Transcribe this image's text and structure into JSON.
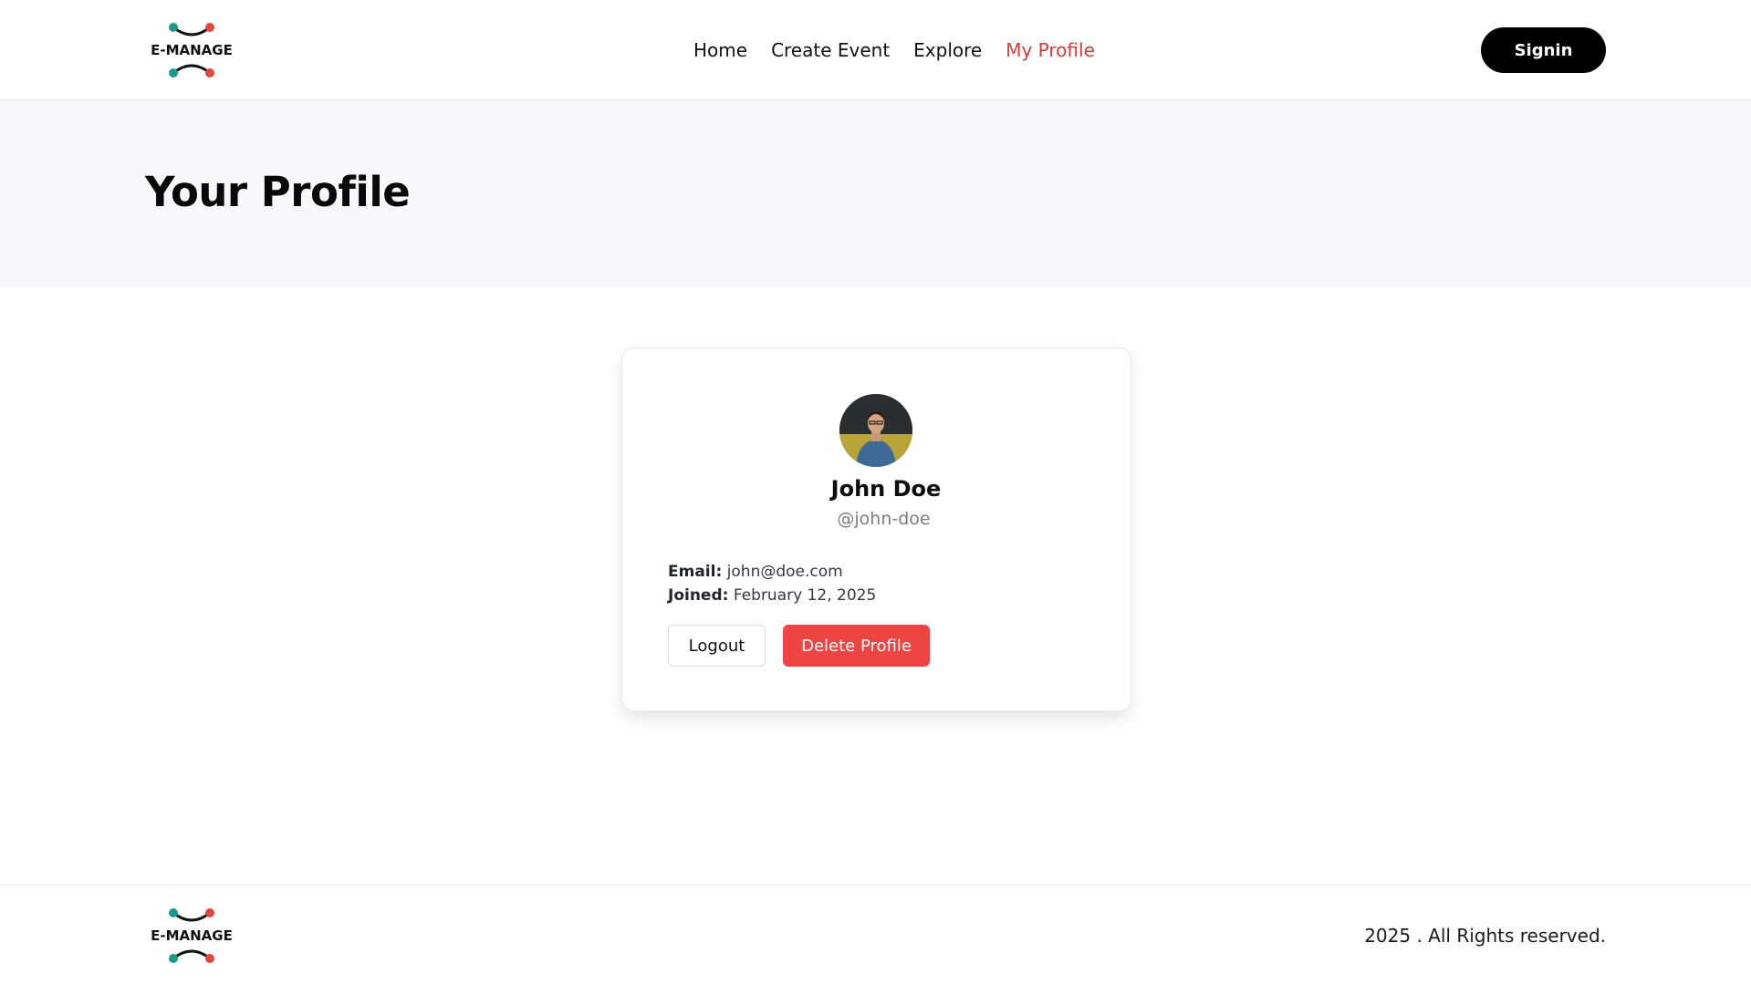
{
  "brand": {
    "logo_text": "E-MANAGE",
    "colors": {
      "teal": "#1a9a8a",
      "red": "#e3463a",
      "accent_red": "#d63a3a",
      "delete_red": "#ee4444"
    }
  },
  "nav": {
    "items": [
      {
        "label": "Home",
        "active": false
      },
      {
        "label": "Create Event",
        "active": false
      },
      {
        "label": "Explore",
        "active": false
      },
      {
        "label": "My Profile",
        "active": true
      }
    ],
    "signin_label": "Signin"
  },
  "page": {
    "title": "Your Profile"
  },
  "profile": {
    "avatar_icon": "user-photo",
    "name": "John Doe",
    "handle": "@john-doe",
    "email_label": "Email:",
    "email": "john@doe.com",
    "joined_label": "Joined:",
    "joined": "February 12, 2025",
    "logout_label": "Logout",
    "delete_label": "Delete Profile"
  },
  "footer": {
    "copyright": "2025 . All Rights reserved."
  }
}
